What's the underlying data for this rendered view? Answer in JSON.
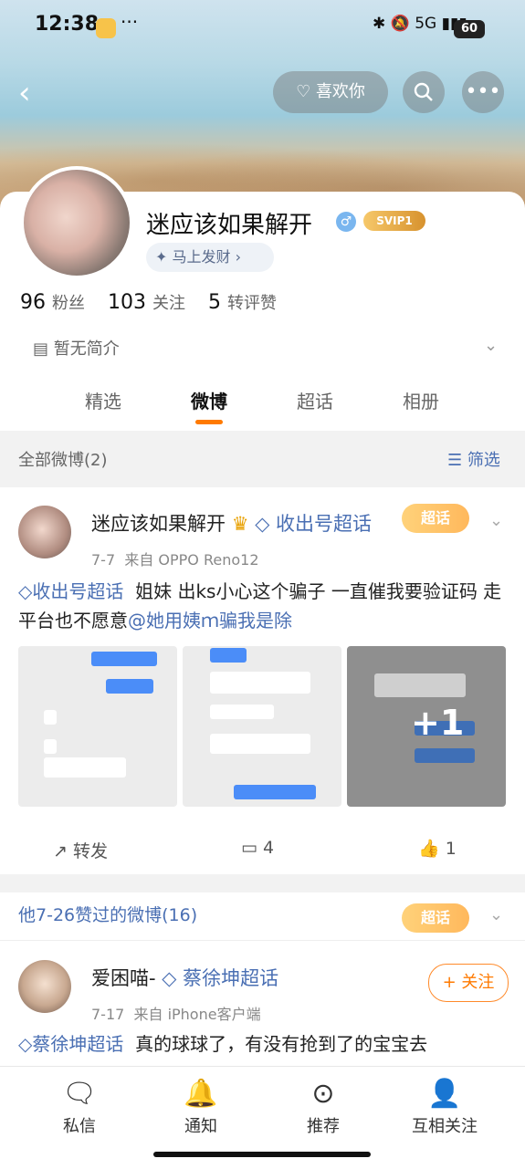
{
  "status_bar": {
    "time": "12:38",
    "dots": "···",
    "network": "5G",
    "battery": "60"
  },
  "header": {
    "like_label": "喜欢你"
  },
  "profile": {
    "name": "迷应该如果解开",
    "vip": "SVIP1",
    "fortune": "马上发财 ›",
    "stats": [
      {
        "value": "96",
        "label": "粉丝"
      },
      {
        "value": "103",
        "label": "关注"
      },
      {
        "value": "5",
        "label": "转评赞"
      }
    ],
    "bio": "暂无简介"
  },
  "tabs": [
    "精选",
    "微博",
    "超话",
    "相册"
  ],
  "feed_header": {
    "all_label": "全部微博(2)",
    "filter_label": "筛选"
  },
  "post1": {
    "author": "迷应该如果解开",
    "topic": "收出号超话",
    "badge": "超话",
    "date": "7-7",
    "source": "来自 OPPO Reno12",
    "text_topic": "收出号超话",
    "text": "姐妹 出ks小心这个骗子 一直催我要验证码 走平台也不愿意",
    "mention": "@她用姨ｍ骗我是除",
    "more_count": "+1",
    "actions": {
      "repost": "转发",
      "comments": "4",
      "likes": "1"
    }
  },
  "liked_section": {
    "title": "他7-26赞过的微博(16)",
    "badge": "超话"
  },
  "post2": {
    "author": "爱困喵-",
    "topic": "蔡徐坤超话",
    "date": "7-17",
    "source": "来自 iPhone客户端",
    "follow": "+ 关注",
    "text_topic": "蔡徐坤超话",
    "text": "真的球球了，有没有抢到了的宝宝去"
  },
  "bottom_nav": [
    {
      "label": "私信",
      "icon": "message-icon"
    },
    {
      "label": "通知",
      "icon": "bell-icon"
    },
    {
      "label": "推荐",
      "icon": "compass-icon"
    },
    {
      "label": "互相关注",
      "icon": "mutual-follow-icon"
    }
  ],
  "colors": {
    "accent": "#ff7a00",
    "link": "#4a6fb3"
  }
}
